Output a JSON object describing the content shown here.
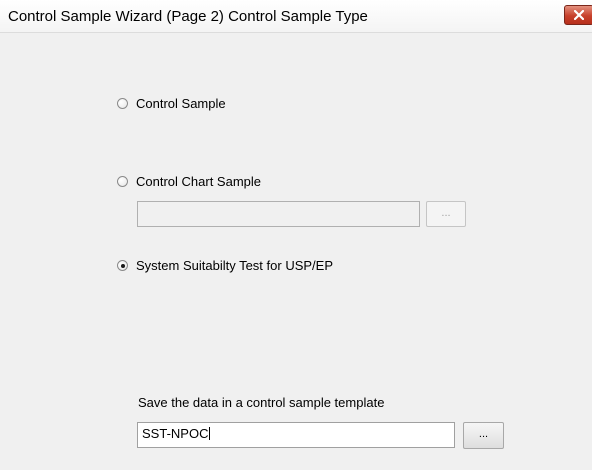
{
  "window": {
    "title": "Control Sample Wizard (Page 2) Control Sample Type"
  },
  "options": {
    "control_sample": {
      "label": "Control Sample",
      "selected": false
    },
    "control_chart_sample": {
      "label": "Control Chart Sample",
      "selected": false,
      "field_value": "",
      "browse_label": "..."
    },
    "system_suitability": {
      "label": "System Suitabilty Test for USP/EP",
      "selected": true
    }
  },
  "template": {
    "label": "Save the data in a control sample template",
    "value": "SST-NPOC",
    "browse_label": "..."
  },
  "icons": {
    "close": "close-icon"
  }
}
